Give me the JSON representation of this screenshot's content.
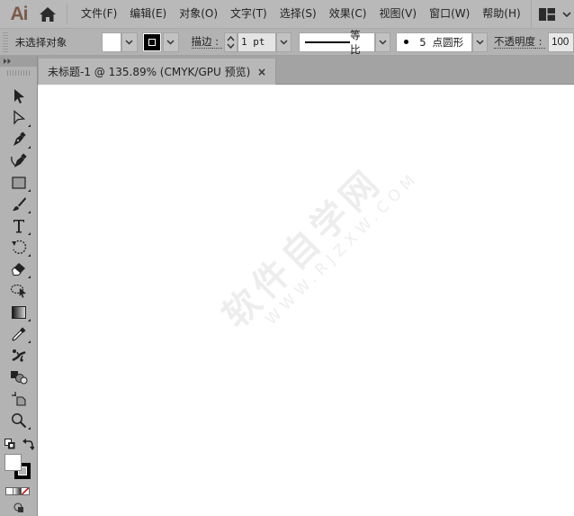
{
  "app": {
    "logo_text": "Ai",
    "brand_color": "#7a5a4a"
  },
  "menubar": {
    "items": [
      {
        "label": "文件(F)"
      },
      {
        "label": "编辑(E)"
      },
      {
        "label": "对象(O)"
      },
      {
        "label": "文字(T)"
      },
      {
        "label": "选择(S)"
      },
      {
        "label": "效果(C)"
      },
      {
        "label": "视图(V)"
      },
      {
        "label": "窗口(W)"
      },
      {
        "label": "帮助(H)"
      }
    ],
    "home_icon": "home-icon",
    "workspace_icon": "workspace-layout-icon"
  },
  "controlbar": {
    "selection_status": "未选择对象",
    "fill_color": "#ffffff",
    "stroke_color": "#000000",
    "stroke_label": "描边",
    "stroke_weight": "1 pt",
    "stroke_profile": "等比",
    "brush_size": "5",
    "brush_name": "点圆形",
    "opacity_label": "不透明度",
    "opacity_value": "100"
  },
  "tools": [
    {
      "name": "selection-tool",
      "icon": "arrow-filled"
    },
    {
      "name": "direct-selection-tool",
      "icon": "arrow-outline"
    },
    {
      "name": "pen-tool",
      "icon": "pen"
    },
    {
      "name": "curvature-tool",
      "icon": "curvature-pen"
    },
    {
      "name": "rectangle-tool",
      "icon": "rectangle"
    },
    {
      "name": "paintbrush-tool",
      "icon": "brush"
    },
    {
      "name": "type-tool",
      "icon": "T"
    },
    {
      "name": "rotate-tool",
      "icon": "rotate"
    },
    {
      "name": "eraser-tool",
      "icon": "eraser"
    },
    {
      "name": "lasso-select-tool",
      "icon": "lasso"
    },
    {
      "name": "gradient-tool",
      "icon": "gradient"
    },
    {
      "name": "eyedropper-tool",
      "icon": "eyedropper"
    },
    {
      "name": "puppet-warp-tool",
      "icon": "puppet"
    },
    {
      "name": "shape-builder-tool",
      "icon": "shape-builder"
    },
    {
      "name": "artboard-tool",
      "icon": "artboard"
    },
    {
      "name": "zoom-tool",
      "icon": "magnifier"
    }
  ],
  "color_controls": {
    "fill": "#ffffff",
    "stroke": "#000000",
    "mode_none_color": "#cc2233"
  },
  "document": {
    "tab_title": "未标题-1 @ 135.89% (CMYK/GPU 预览)",
    "close_label": "×"
  },
  "watermark": {
    "text_cn": "软件自学网",
    "text_url": "WWW.RJZXW.COM"
  }
}
